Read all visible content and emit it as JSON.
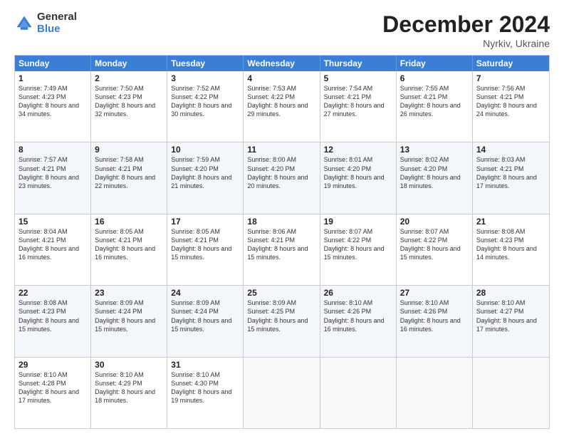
{
  "logo": {
    "general": "General",
    "blue": "Blue"
  },
  "title": "December 2024",
  "location": "Nyrkiv, Ukraine",
  "days": [
    "Sunday",
    "Monday",
    "Tuesday",
    "Wednesday",
    "Thursday",
    "Friday",
    "Saturday"
  ],
  "weeks": [
    [
      {
        "day": "1",
        "rise": "7:49 AM",
        "set": "4:23 PM",
        "daylight": "8 hours and 34 minutes."
      },
      {
        "day": "2",
        "rise": "7:50 AM",
        "set": "4:23 PM",
        "daylight": "8 hours and 32 minutes."
      },
      {
        "day": "3",
        "rise": "7:52 AM",
        "set": "4:22 PM",
        "daylight": "8 hours and 30 minutes."
      },
      {
        "day": "4",
        "rise": "7:53 AM",
        "set": "4:22 PM",
        "daylight": "8 hours and 29 minutes."
      },
      {
        "day": "5",
        "rise": "7:54 AM",
        "set": "4:21 PM",
        "daylight": "8 hours and 27 minutes."
      },
      {
        "day": "6",
        "rise": "7:55 AM",
        "set": "4:21 PM",
        "daylight": "8 hours and 26 minutes."
      },
      {
        "day": "7",
        "rise": "7:56 AM",
        "set": "4:21 PM",
        "daylight": "8 hours and 24 minutes."
      }
    ],
    [
      {
        "day": "8",
        "rise": "7:57 AM",
        "set": "4:21 PM",
        "daylight": "8 hours and 23 minutes."
      },
      {
        "day": "9",
        "rise": "7:58 AM",
        "set": "4:21 PM",
        "daylight": "8 hours and 22 minutes."
      },
      {
        "day": "10",
        "rise": "7:59 AM",
        "set": "4:20 PM",
        "daylight": "8 hours and 21 minutes."
      },
      {
        "day": "11",
        "rise": "8:00 AM",
        "set": "4:20 PM",
        "daylight": "8 hours and 20 minutes."
      },
      {
        "day": "12",
        "rise": "8:01 AM",
        "set": "4:20 PM",
        "daylight": "8 hours and 19 minutes."
      },
      {
        "day": "13",
        "rise": "8:02 AM",
        "set": "4:20 PM",
        "daylight": "8 hours and 18 minutes."
      },
      {
        "day": "14",
        "rise": "8:03 AM",
        "set": "4:21 PM",
        "daylight": "8 hours and 17 minutes."
      }
    ],
    [
      {
        "day": "15",
        "rise": "8:04 AM",
        "set": "4:21 PM",
        "daylight": "8 hours and 16 minutes."
      },
      {
        "day": "16",
        "rise": "8:05 AM",
        "set": "4:21 PM",
        "daylight": "8 hours and 16 minutes."
      },
      {
        "day": "17",
        "rise": "8:05 AM",
        "set": "4:21 PM",
        "daylight": "8 hours and 15 minutes."
      },
      {
        "day": "18",
        "rise": "8:06 AM",
        "set": "4:21 PM",
        "daylight": "8 hours and 15 minutes."
      },
      {
        "day": "19",
        "rise": "8:07 AM",
        "set": "4:22 PM",
        "daylight": "8 hours and 15 minutes."
      },
      {
        "day": "20",
        "rise": "8:07 AM",
        "set": "4:22 PM",
        "daylight": "8 hours and 15 minutes."
      },
      {
        "day": "21",
        "rise": "8:08 AM",
        "set": "4:23 PM",
        "daylight": "8 hours and 14 minutes."
      }
    ],
    [
      {
        "day": "22",
        "rise": "8:08 AM",
        "set": "4:23 PM",
        "daylight": "8 hours and 15 minutes."
      },
      {
        "day": "23",
        "rise": "8:09 AM",
        "set": "4:24 PM",
        "daylight": "8 hours and 15 minutes."
      },
      {
        "day": "24",
        "rise": "8:09 AM",
        "set": "4:24 PM",
        "daylight": "8 hours and 15 minutes."
      },
      {
        "day": "25",
        "rise": "8:09 AM",
        "set": "4:25 PM",
        "daylight": "8 hours and 15 minutes."
      },
      {
        "day": "26",
        "rise": "8:10 AM",
        "set": "4:26 PM",
        "daylight": "8 hours and 16 minutes."
      },
      {
        "day": "27",
        "rise": "8:10 AM",
        "set": "4:26 PM",
        "daylight": "8 hours and 16 minutes."
      },
      {
        "day": "28",
        "rise": "8:10 AM",
        "set": "4:27 PM",
        "daylight": "8 hours and 17 minutes."
      }
    ],
    [
      {
        "day": "29",
        "rise": "8:10 AM",
        "set": "4:28 PM",
        "daylight": "8 hours and 17 minutes."
      },
      {
        "day": "30",
        "rise": "8:10 AM",
        "set": "4:29 PM",
        "daylight": "8 hours and 18 minutes."
      },
      {
        "day": "31",
        "rise": "8:10 AM",
        "set": "4:30 PM",
        "daylight": "8 hours and 19 minutes."
      },
      null,
      null,
      null,
      null
    ]
  ],
  "row_alt": [
    false,
    true,
    false,
    true,
    false
  ]
}
